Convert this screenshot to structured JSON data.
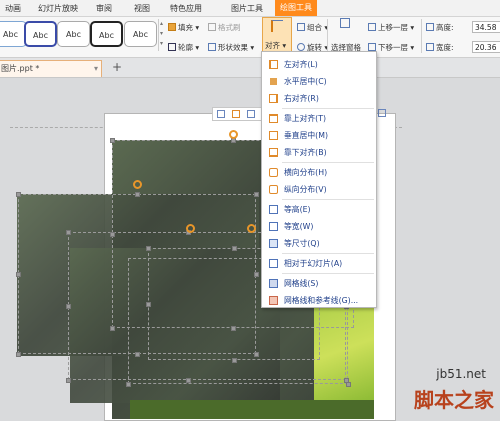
{
  "tabs": [
    {
      "label": "动画"
    },
    {
      "label": "幻灯片放映"
    },
    {
      "label": "审阅"
    },
    {
      "label": "视图"
    },
    {
      "label": "特色应用"
    },
    {
      "label": "图片工具"
    },
    {
      "label": "绘图工具"
    }
  ],
  "ribbon": {
    "shape_styles": [
      "Abc",
      "Abc",
      "Abc",
      "Abc",
      "Abc"
    ],
    "fill": "填充",
    "format_painter": "格式刷",
    "outline": "轮廓",
    "shape_effects": "形状效果",
    "align": "对齐",
    "group": "组合",
    "rotate": "旋转",
    "selection_pane": "选择窗格",
    "bring_forward": "上移一层",
    "send_backward": "下移一层",
    "height_label": "高度:",
    "height_value": "34.58",
    "width_label": "宽度:",
    "width_value": "20.36"
  },
  "document": {
    "tab_label": "图片.ppt *",
    "add_tab": "+"
  },
  "align_menu": [
    {
      "label": "左对齐(L)"
    },
    {
      "label": "水平居中(C)"
    },
    {
      "label": "右对齐(R)"
    },
    {
      "label": "靠上对齐(T)"
    },
    {
      "label": "垂直居中(M)"
    },
    {
      "label": "靠下对齐(B)"
    },
    {
      "label": "横向分布(H)"
    },
    {
      "label": "纵向分布(V)"
    },
    {
      "label": "等高(E)"
    },
    {
      "label": "等宽(W)"
    },
    {
      "label": "等尺寸(Q)"
    },
    {
      "label": "相对于幻灯片(A)"
    },
    {
      "label": "网格线(S)"
    },
    {
      "label": "网格线和参考线(G)..."
    }
  ],
  "watermark": {
    "line1": "jb51.net",
    "line2": "脚本之家"
  },
  "colors": {
    "active_tab": "#ff8a1c",
    "menu_text": "#1f3f8a",
    "accent_orange": "#e8962a"
  }
}
